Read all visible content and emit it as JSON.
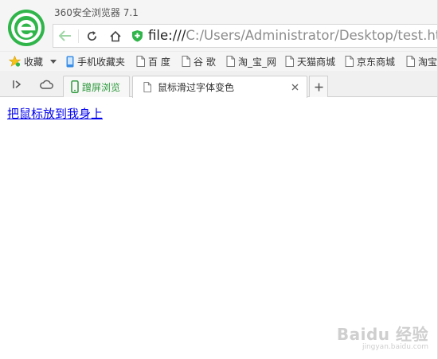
{
  "window": {
    "title": "360安全浏览器 7.1"
  },
  "address_bar": {
    "scheme": "file:///",
    "path": "C:/Users/Administrator/Desktop/test.html"
  },
  "bookmarks": [
    {
      "label": "收藏",
      "icon": "star-icon"
    },
    {
      "label": "手机收藏夹",
      "icon": "phone-icon"
    },
    {
      "label": "百 度",
      "icon": "page-icon"
    },
    {
      "label": "谷 歌",
      "icon": "page-icon"
    },
    {
      "label": "淘_宝_网",
      "icon": "page-icon"
    },
    {
      "label": "天猫商城",
      "icon": "page-icon"
    },
    {
      "label": "京东商城",
      "icon": "page-icon"
    },
    {
      "label": "淘宝",
      "icon": "page-icon"
    }
  ],
  "tabs": [
    {
      "label": "蹭屏浏览",
      "icon": "phone-icon",
      "color": "#2e9a3d"
    },
    {
      "label": "鼠标滑过字体变色",
      "icon": "page-icon",
      "active": true
    }
  ],
  "page": {
    "link_text": "把鼠标放到我身上"
  },
  "watermark": {
    "main": "Baidu 经验",
    "sub": "jingyan.baidu.com"
  },
  "colors": {
    "brand_green": "#2fb54a",
    "link": "#0000ee"
  }
}
